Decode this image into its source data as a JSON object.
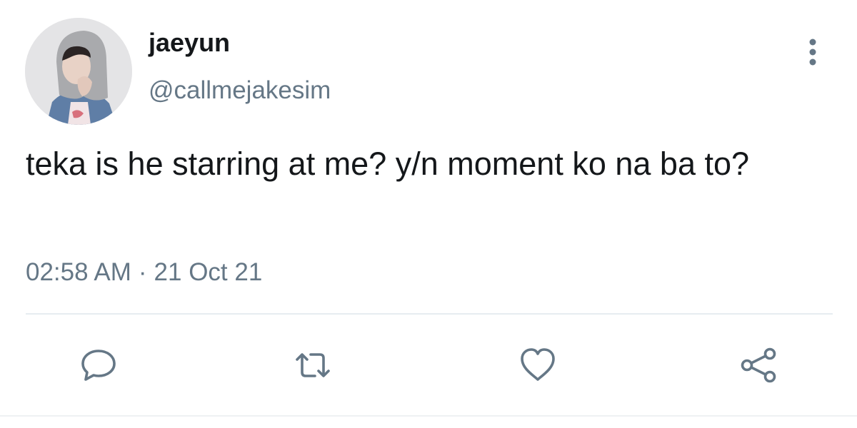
{
  "author": {
    "display_name": "jaeyun",
    "handle": "@callmejakesim",
    "avatar_icon": "profile-photo"
  },
  "tweet": {
    "text": "teka is he starring at me? y/n moment ko na ba to?",
    "time": "02:58 AM",
    "separator": "·",
    "date": "21 Oct 21"
  },
  "actions": {
    "reply_icon": "comment-bubble-icon",
    "retweet_icon": "retweet-arrows-icon",
    "like_icon": "heart-icon",
    "share_icon": "share-nodes-icon",
    "more_icon": "vertical-dots-icon"
  },
  "colors": {
    "text_primary": "#14171a",
    "text_secondary": "#657786",
    "icon": "#657786",
    "divider": "#e6ecf0"
  }
}
